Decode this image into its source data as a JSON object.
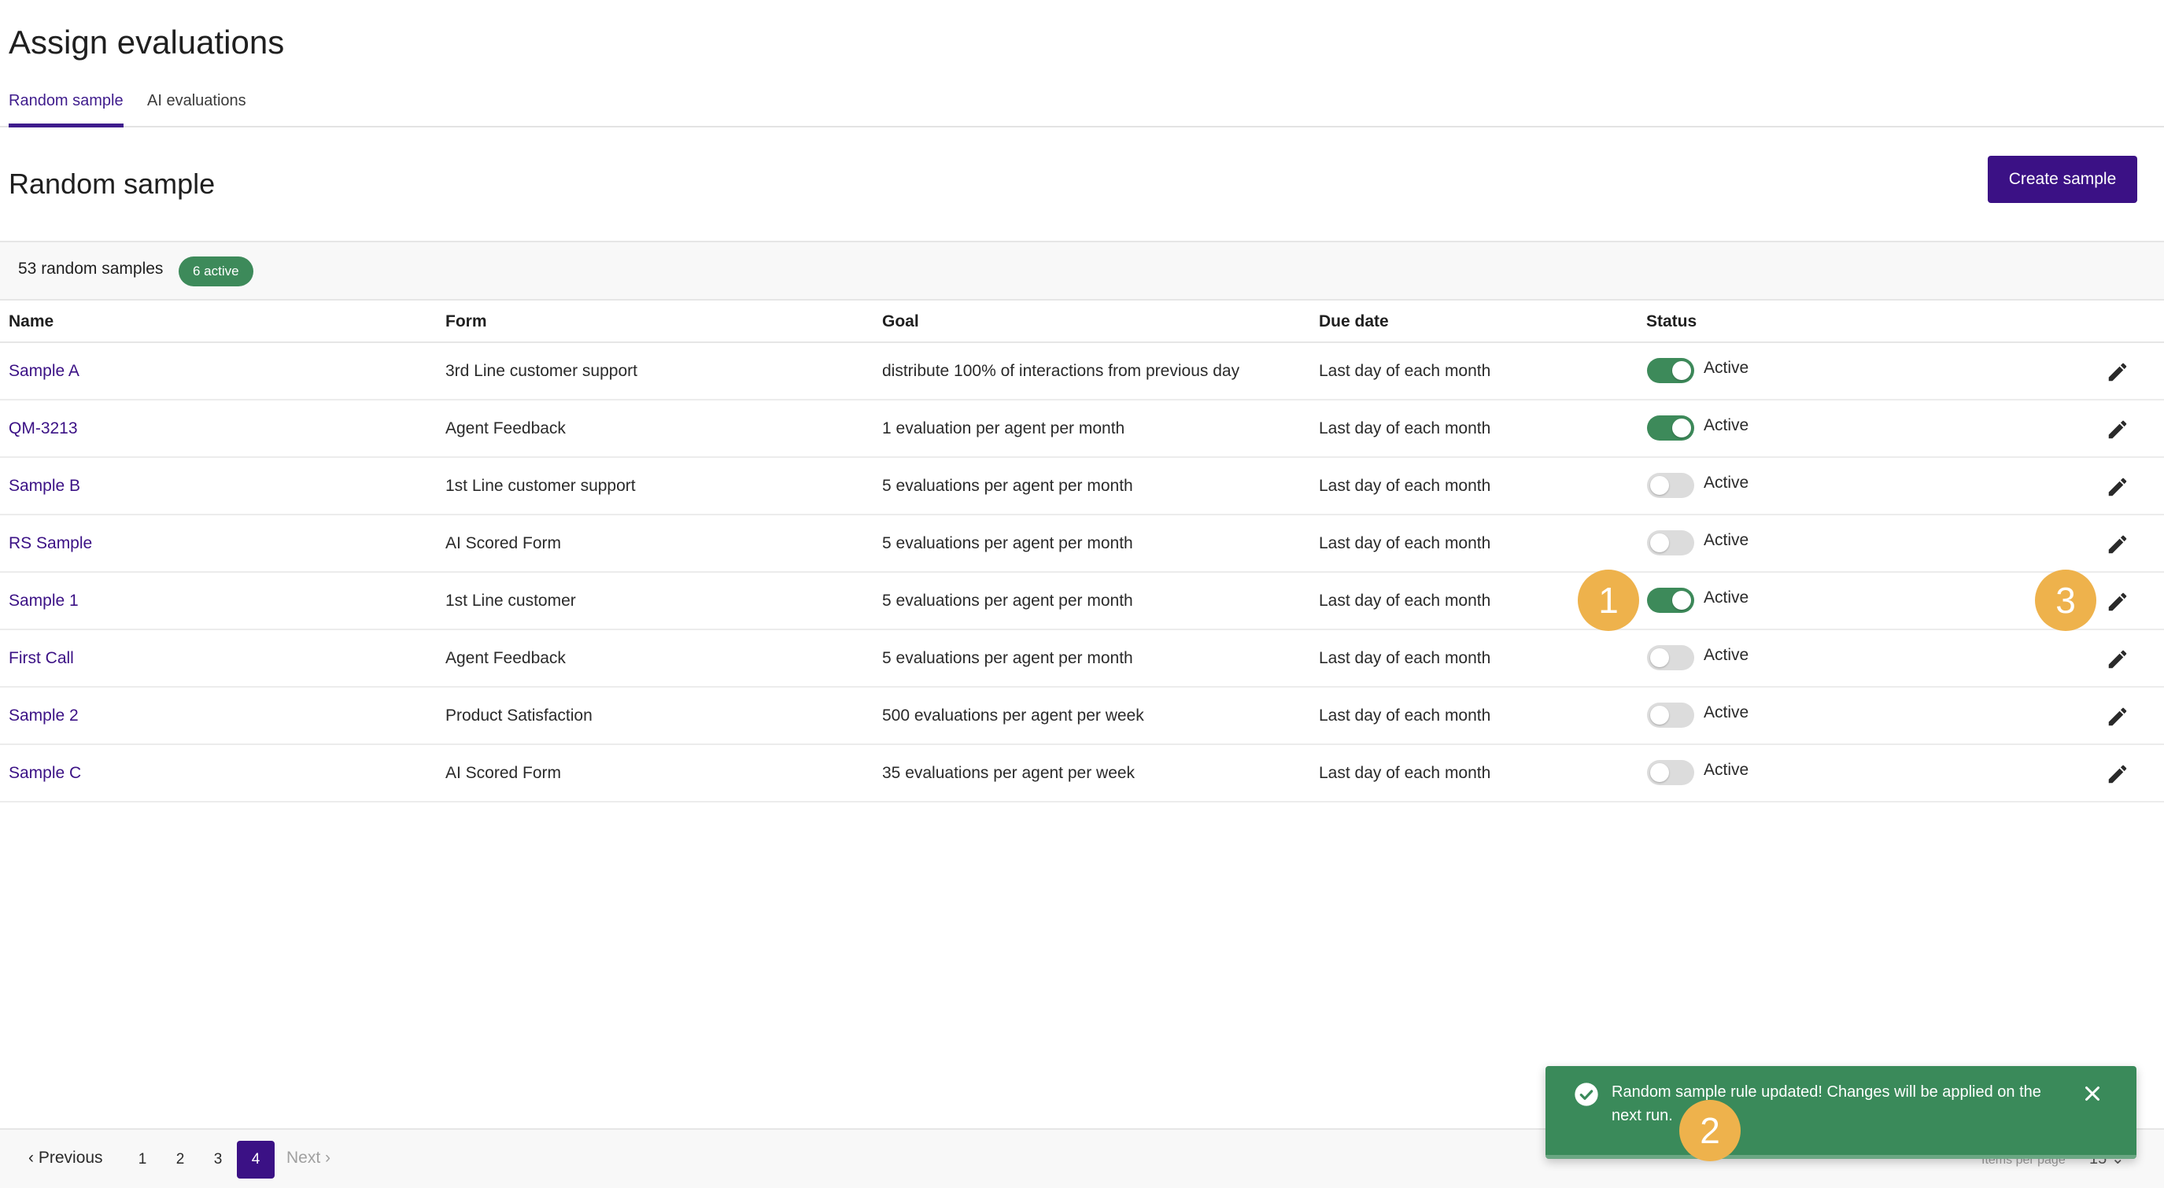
{
  "header": {
    "title": "Assign evaluations"
  },
  "tabs": [
    {
      "label": "Random sample",
      "active": true
    },
    {
      "label": "AI evaluations",
      "active": false
    }
  ],
  "section": {
    "title": "Random sample",
    "create_button": "Create sample"
  },
  "summary": {
    "count_text": "53 random samples",
    "active_badge": "6 active"
  },
  "table": {
    "columns": [
      "Name",
      "Form",
      "Goal",
      "Due date",
      "Status"
    ],
    "rows": [
      {
        "name": "Sample A",
        "form": "3rd Line customer support",
        "goal": "distribute 100% of interactions from previous day",
        "due": "Last day of each month",
        "status_label": "Active",
        "enabled": true
      },
      {
        "name": "QM-3213",
        "form": "Agent Feedback",
        "goal": "1 evaluation per agent per month",
        "due": "Last day of each month",
        "status_label": "Active",
        "enabled": true
      },
      {
        "name": "Sample B",
        "form": "1st Line customer support",
        "goal": "5 evaluations per agent per month",
        "due": "Last day of each month",
        "status_label": "Active",
        "enabled": false
      },
      {
        "name": "RS Sample",
        "form": "AI Scored Form",
        "goal": "5 evaluations per agent per month",
        "due": "Last day of each month",
        "status_label": "Active",
        "enabled": false
      },
      {
        "name": "Sample 1",
        "form": "1st Line customer",
        "goal": "5 evaluations per agent per month",
        "due": "Last day of each month",
        "status_label": "Active",
        "enabled": true
      },
      {
        "name": "First Call",
        "form": "Agent Feedback",
        "goal": "5 evaluations per agent per month",
        "due": "Last day of each month",
        "status_label": "Active",
        "enabled": false
      },
      {
        "name": "Sample 2",
        "form": "Product Satisfaction",
        "goal": "500 evaluations per agent per week",
        "due": "Last day of each month",
        "status_label": "Active",
        "enabled": false
      },
      {
        "name": "Sample C",
        "form": "AI Scored Form",
        "goal": "35 evaluations per agent per week",
        "due": "Last day of each month",
        "status_label": "Active",
        "enabled": false
      }
    ]
  },
  "callouts": [
    "1",
    "2",
    "3"
  ],
  "pagination": {
    "previous": "Previous",
    "pages": [
      "1",
      "2",
      "3",
      "4"
    ],
    "current_page": "4",
    "next": "Next",
    "items_per_page_label": "Items per page",
    "items_per_page_value": "15"
  },
  "toast": {
    "message": "Random sample rule updated! Changes will be applied on the next run."
  },
  "colors": {
    "brand": "#3b1185",
    "success": "#3d8a5a",
    "callout": "#eeb24c"
  },
  "icons": {
    "edit": "pencil-icon",
    "toast_status": "check-circle-icon",
    "toast_close": "close-icon",
    "prev": "chevron-left-icon",
    "next": "chevron-right-icon"
  }
}
